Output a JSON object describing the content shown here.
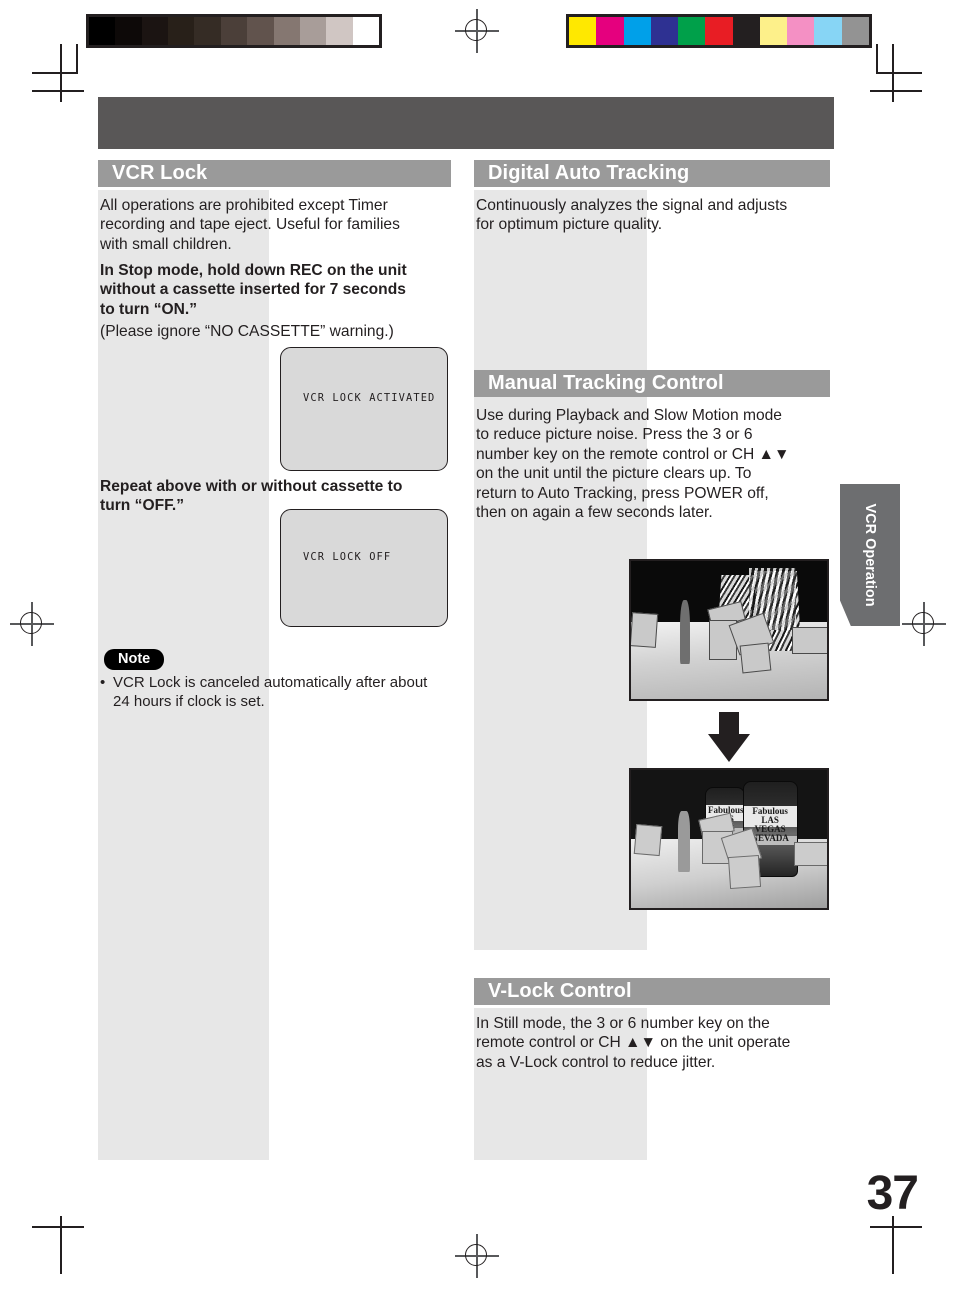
{
  "document": {
    "page_number": "37",
    "side_tab_label": "VCR\nOperation",
    "banner_color": "#595757",
    "heading_bar_color": "#9a9a9a",
    "column_block_color": "#e7e7e7",
    "text_color": "#231f20"
  },
  "calibration": {
    "grayscale_swatches": [
      "#000000",
      "#0d0908",
      "#1b1412",
      "#282019",
      "#352c25",
      "#4b3f39",
      "#61534d",
      "#857771",
      "#a89d99",
      "#d0c6c3",
      "#ffffff"
    ],
    "color_swatches": [
      "#ffe800",
      "#e5007e",
      "#00a0e9",
      "#2e3192",
      "#00a04a",
      "#e81d24",
      "#231f20",
      "#fdf08a",
      "#f490c4",
      "#87d5f5",
      "#939393"
    ]
  },
  "sections": {
    "vcr_lock": {
      "title": "VCR Lock",
      "intro": "All operations are prohibited except Timer\nrecording and tape eject. Useful for families\nwith small children.",
      "bold_step": "In Stop mode, hold down REC on the unit\nwithout a cassette inserted for 7 seconds\nto turn “ON.”",
      "parenthetical": "(Please ignore “NO CASSETTE” warning.)",
      "osd_on_text": "VCR LOCK ACTIVATED",
      "repeat_step": "Repeat above with or without cassette to\nturn “OFF.”",
      "osd_off_text": "VCR LOCK OFF",
      "note_label": "Note",
      "note_bullet": "•",
      "note_text": "VCR Lock is canceled automatically after about\n24 hours if clock is set."
    },
    "digital_auto_tracking": {
      "title": "Digital Auto Tracking",
      "body": "Continuously analyzes the signal and adjusts\nfor optimum picture quality."
    },
    "manual_tracking_control": {
      "title": "Manual Tracking Control",
      "body": "Use during Playback and Slow Motion mode\nto reduce picture noise. Press the 3 or 6\nnumber key on the remote control or CH ▲▼\non the unit until the picture clears up. To\nreturn to Auto Tracking, press POWER off,\nthen on again a few seconds later.",
      "figure_before_caption": "",
      "figure_after_caption": "",
      "photo_can_label_big": "Fabulous\nLAS VEGAS\nNEVADA",
      "photo_can_label_small": "Fabulous\nLAS VEG"
    },
    "v_lock_control": {
      "title": "V-Lock Control",
      "body": "In Still mode, the 3 or 6 number key on the\nremote control or CH ▲▼ on the unit operate\nas a V-Lock control to reduce jitter."
    }
  }
}
